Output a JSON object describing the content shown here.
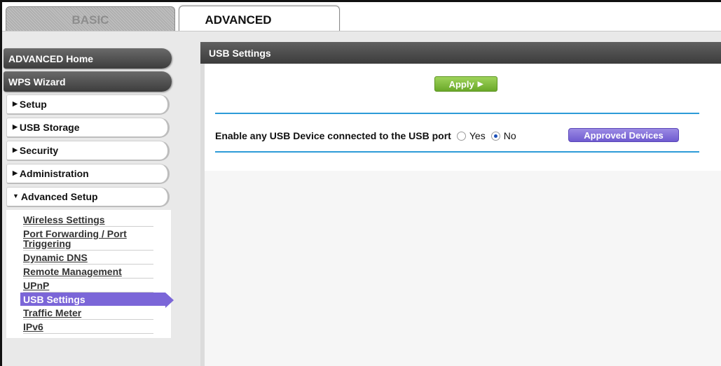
{
  "tabs": {
    "basic": "BASIC",
    "advanced": "ADVANCED"
  },
  "sidebar": {
    "advanced_home": "ADVANCED Home",
    "wps_wizard": "WPS Wizard",
    "sections": [
      {
        "label": "Setup",
        "marker": "▶"
      },
      {
        "label": "USB Storage",
        "marker": "▶"
      },
      {
        "label": "Security",
        "marker": "▶"
      },
      {
        "label": "Administration",
        "marker": "▶"
      },
      {
        "label": "Advanced Setup",
        "marker": "▼"
      }
    ],
    "advanced_setup_items": [
      "Wireless Settings",
      "Port Forwarding / Port Triggering",
      "Dynamic DNS",
      "Remote Management",
      "UPnP",
      "USB Settings",
      "Traffic Meter",
      "IPv6"
    ],
    "active_item": "USB Settings"
  },
  "main": {
    "title": "USB Settings",
    "apply_label": "Apply",
    "apply_arrow": "▶",
    "usb_enable_label": "Enable any USB Device connected to the USB port",
    "radio_yes": "Yes",
    "radio_no": "No",
    "selected": "No",
    "approved_devices_label": "Approved Devices"
  },
  "colors": {
    "active_item": "#7b66d8",
    "apply_button": "#7fbe3a",
    "divider": "#2d9bd8",
    "approved_button": "#7b66d8"
  }
}
